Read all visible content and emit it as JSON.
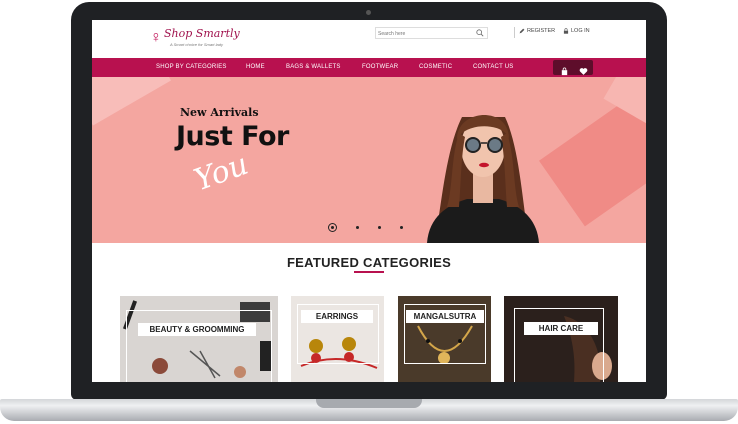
{
  "site": {
    "logo_name": "Shop Smartly",
    "logo_tagline": "A Smart choice for Smart lady"
  },
  "header": {
    "search_placeholder": "Search here",
    "register_label": "REGISTER",
    "login_label": "LOG IN"
  },
  "nav": {
    "items": [
      "SHOP BY CATEGORIES",
      "HOME",
      "BAGS & WALLETS",
      "FOOTWEAR",
      "COSMETIC",
      "CONTACT US"
    ]
  },
  "hero": {
    "subtitle": "New Arrivals",
    "title": "Just For",
    "script": "You",
    "slide_count": 4,
    "active_slide": 1
  },
  "featured": {
    "title": "FEATURED CATEGORIES",
    "categories": [
      "BEAUTY & GROOMMING",
      "EARRINGS",
      "MANGALSUTRA",
      "HAIR CARE"
    ]
  },
  "colors": {
    "brand": "#b8114f",
    "hero_bg": "#f4a6a0"
  }
}
